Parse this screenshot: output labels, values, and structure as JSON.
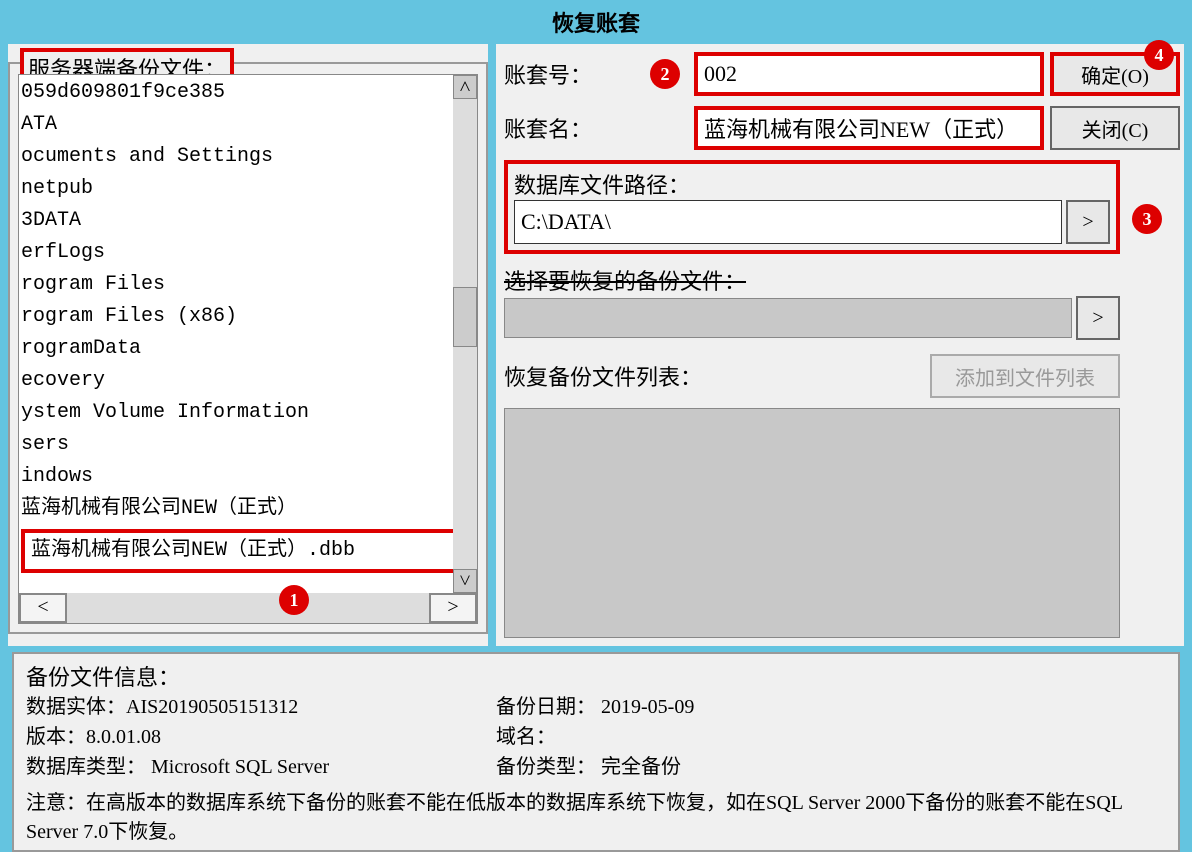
{
  "window_title": "恢复账套",
  "left": {
    "legend": "服务器端备份文件：",
    "items": [
      "059d609801f9ce385",
      "ATA",
      "ocuments and Settings",
      "netpub",
      "3DATA",
      "erfLogs",
      "rogram Files",
      "rogram Files (x86)",
      "rogramData",
      "ecovery",
      "ystem Volume Information",
      "sers",
      "indows",
      "蓝海机械有限公司NEW（正式）"
    ],
    "selected_file": "蓝海机械有限公司NEW（正式）.dbb"
  },
  "right": {
    "account_no_label": "账套号：",
    "account_no": "002",
    "account_name_label": "账套名：",
    "account_name": "蓝海机械有限公司NEW（正式）",
    "db_path_label": "数据库文件路径：",
    "db_path": "C:\\DATA\\",
    "select_backup_label": "选择要恢复的备份文件：",
    "restore_list_label": "恢复备份文件列表：",
    "ok_btn": "确定(O)",
    "close_btn": "关闭(C)",
    "add_btn": "添加到文件列表"
  },
  "info": {
    "title": "备份文件信息：",
    "entity_label": "数据实体：",
    "entity": "AIS20190505151312",
    "backup_date_label": "备份日期：",
    "backup_date": "2019-05-09",
    "version_label": "版本：",
    "version": "8.0.01.08",
    "domain_label": "域名：",
    "domain": "",
    "dbtype_label": "数据库类型：",
    "dbtype": "Microsoft SQL Server",
    "backup_type_label": "备份类型：",
    "backup_type": "完全备份",
    "note": "注意：在高版本的数据库系统下备份的账套不能在低版本的数据库系统下恢复，如在SQL Server 2000下备份的账套不能在SQL Server 7.0下恢复。"
  },
  "badges": {
    "b1": "1",
    "b2": "2",
    "b3": "3",
    "b4": "4"
  }
}
